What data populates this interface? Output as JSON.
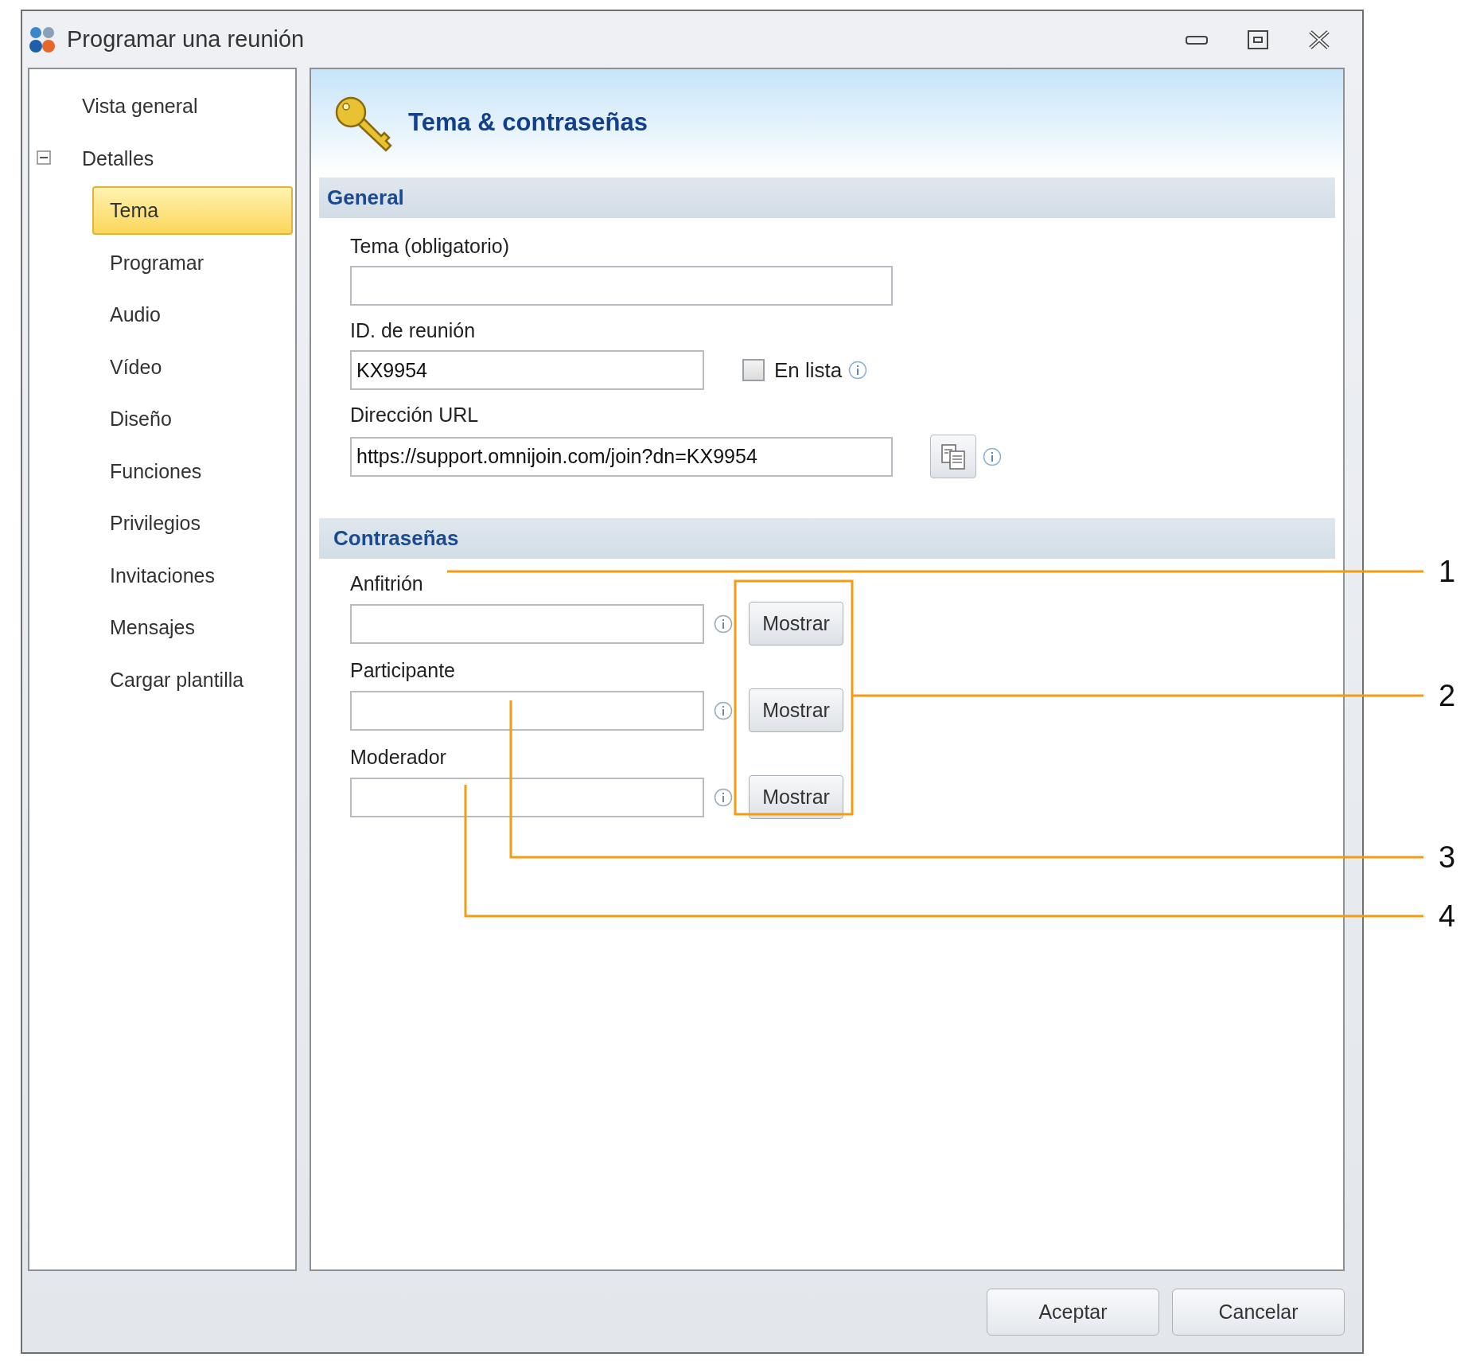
{
  "window": {
    "title": "Programar una reunión"
  },
  "sidebar": {
    "items": [
      {
        "label": "Vista general",
        "selected": false
      },
      {
        "label": "Detalles",
        "selected": false,
        "expanded": true,
        "children": [
          {
            "label": "Tema",
            "selected": true
          },
          {
            "label": "Programar",
            "selected": false
          },
          {
            "label": "Audio",
            "selected": false
          },
          {
            "label": "Vídeo",
            "selected": false
          },
          {
            "label": "Diseño",
            "selected": false
          },
          {
            "label": "Funciones",
            "selected": false
          },
          {
            "label": "Privilegios",
            "selected": false
          },
          {
            "label": "Invitaciones",
            "selected": false
          },
          {
            "label": "Mensajes",
            "selected": false
          },
          {
            "label": "Cargar plantilla",
            "selected": false
          }
        ]
      }
    ]
  },
  "header": {
    "title": "Tema & contraseñas"
  },
  "sections": [
    {
      "title": "General",
      "fields": [
        {
          "kind": "text",
          "label": "Tema (obligatorio)"
        },
        {
          "kind": "id",
          "label": "ID. de reunión",
          "value": "KX9954",
          "checkbox": {
            "label": "En lista",
            "checked": false
          }
        },
        {
          "kind": "url",
          "label": "Dirección URL",
          "value": "https://support.omnijoin.com/join?dn=KX9954"
        }
      ]
    },
    {
      "title": "Contraseñas",
      "fields": [
        {
          "kind": "password",
          "label": "Anfitrión",
          "button": "Mostrar"
        },
        {
          "kind": "password",
          "label": "Participante",
          "button": "Mostrar"
        },
        {
          "kind": "password",
          "label": "Moderador",
          "button": "Mostrar"
        }
      ]
    }
  ],
  "buttons": [
    "Aceptar",
    "Cancelar"
  ],
  "callouts": [
    "1",
    "2",
    "3",
    "4"
  ]
}
